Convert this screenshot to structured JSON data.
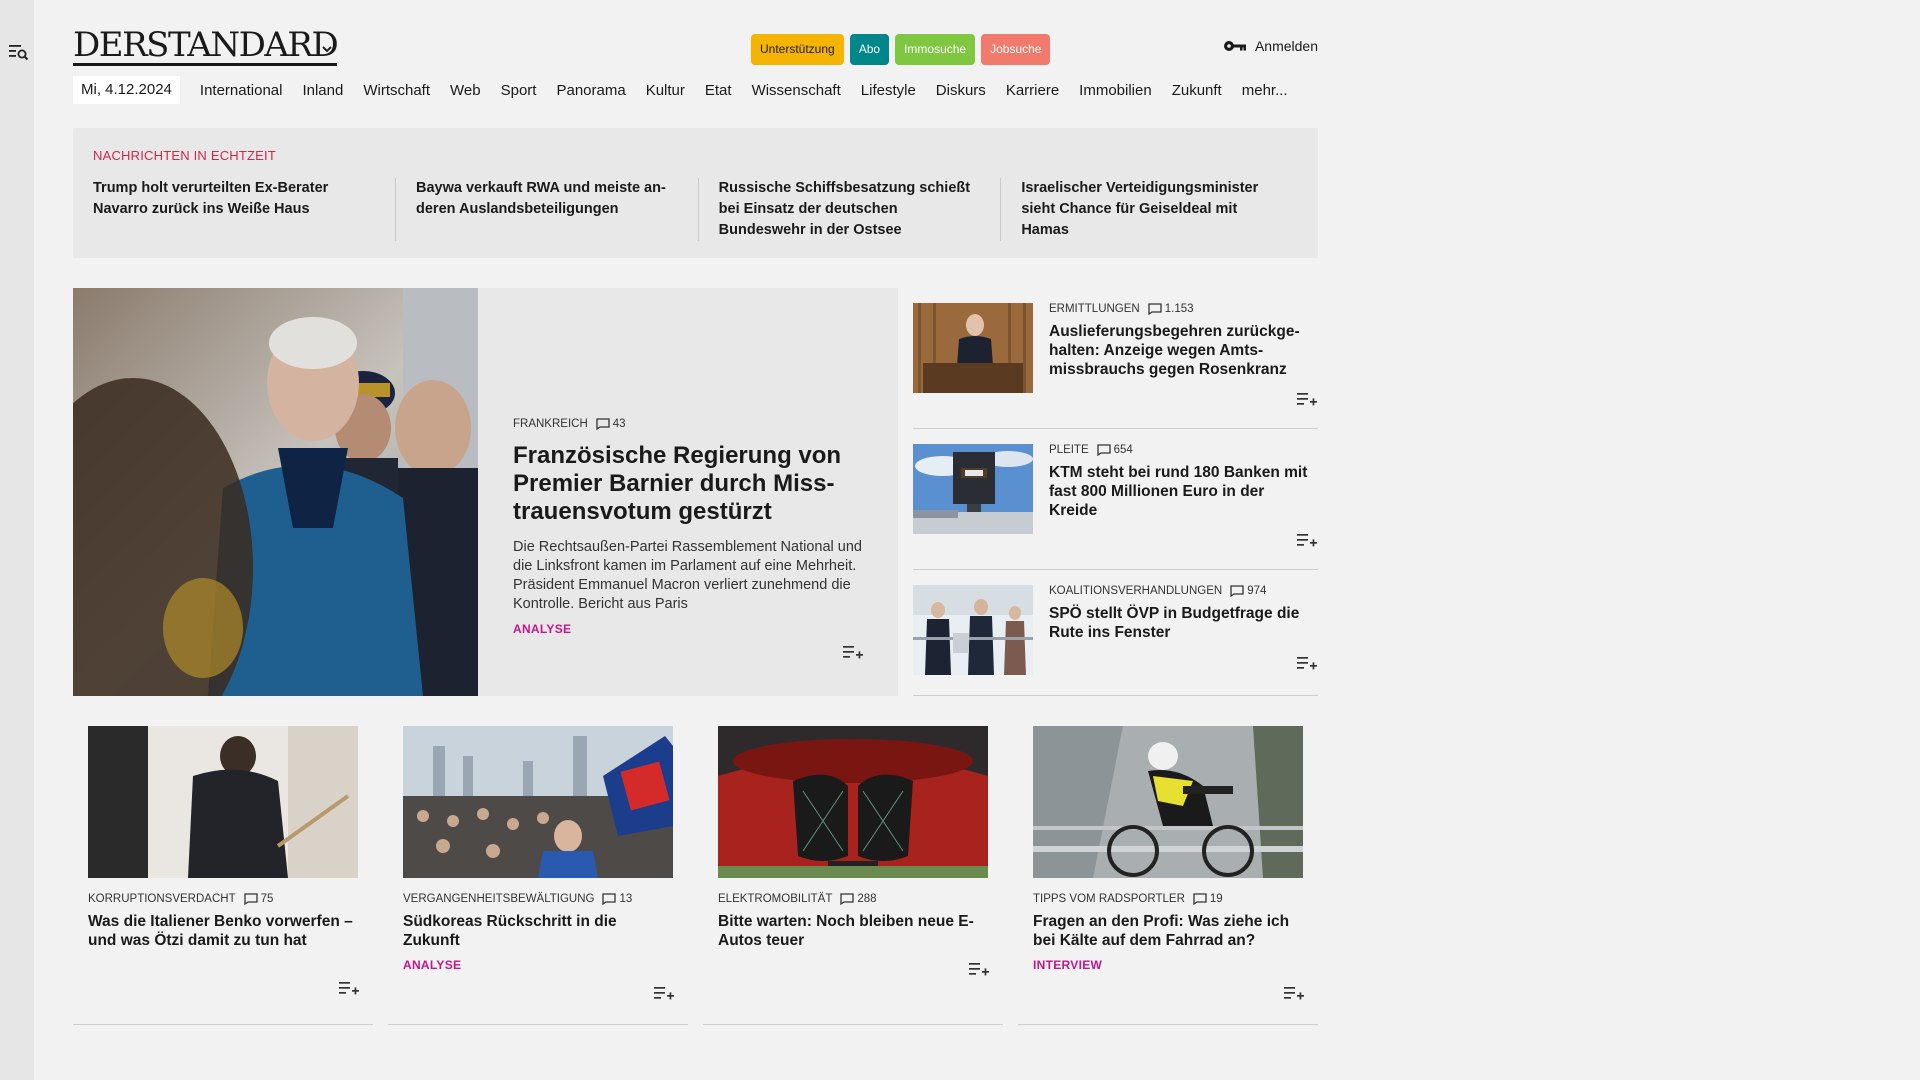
{
  "header": {
    "logo": "DERSTANDARD",
    "pills": [
      "Unterstützung",
      "Abo",
      "Immosuche",
      "Jobsuche"
    ],
    "login": "Anmelden"
  },
  "nav": {
    "date": "Mi, 4.12.2024",
    "items": [
      "International",
      "Inland",
      "Wirtschaft",
      "Web",
      "Sport",
      "Panorama",
      "Kultur",
      "Etat",
      "Wissenschaft",
      "Lifestyle",
      "Diskurs",
      "Karriere",
      "Immobilien",
      "Zukunft",
      "mehr..."
    ]
  },
  "ticker": {
    "label": "NACHRICHTEN IN ECHTZEIT",
    "items": [
      "Trump holt verurteilten Ex-Berater Navarro zurück ins Weiße Haus",
      "Baywa verkauft RWA und meiste an­deren Auslandsbeteiligungen",
      "Russische Schiffsbesatzung schießt bei Einsatz der deutschen Bundeswehr in der Ostsee",
      "Israelischer Verteidigungsminister sieht Chance für Geiseldeal mit Hamas"
    ]
  },
  "lead": {
    "kicker": "FRANKREICH",
    "comments": "43",
    "title": "Französische Regierung von Premier Barnier durch Miss­trauensvotum gestürzt",
    "teaser": "Die Rechtsaußen-Partei Rassemblement National und die Linksfront kamen im Parlament auf eine Mehrheit. Präsident Emmanuel Macron verliert zunehmend die Kontrolle. Bericht aus Paris",
    "tag": "ANALYSE"
  },
  "side": [
    {
      "kicker": "ERMITTLUNGEN",
      "comments": "1.153",
      "title": "Auslieferungsbegehren zurückge­halten: Anzeige wegen Amts­missbrauchs gegen Rosenkranz"
    },
    {
      "kicker": "PLEITE",
      "comments": "654",
      "title": "KTM steht bei rund 180 Banken mit fast 800 Millionen Euro in der Kreide"
    },
    {
      "kicker": "KOALITIONSVERHANDLUNGEN",
      "comments": "974",
      "title": "SPÖ stellt ÖVP in Budgetfrage die Rute ins Fenster"
    }
  ],
  "cards": [
    {
      "kicker": "KORRUPTIONSVERDACHT",
      "comments": "75",
      "title": "Was die Italiener Benko vorwerfen – und was Ötzi damit zu tun hat",
      "tag": ""
    },
    {
      "kicker": "VERGANGENHEITSBEWÄLTIGUNG",
      "comments": "13",
      "title": "Südkoreas Rückschritt in die Zukunft",
      "tag": "ANALYSE"
    },
    {
      "kicker": "ELEKTROMOBILITÄT",
      "comments": "288",
      "title": "Bitte warten: Noch bleiben neue E-Autos teuer",
      "tag": ""
    },
    {
      "kicker": "TIPPS VOM RADSPORTLER",
      "comments": "19",
      "title": "Fragen an den Profi: Was ziehe ich bei Kälte auf dem Fahrrad an?",
      "tag": "INTERVIEW"
    }
  ],
  "icons": [
    "search-menu-icon",
    "chevron-down-icon",
    "key-icon",
    "comment-icon",
    "add-to-list-icon"
  ]
}
